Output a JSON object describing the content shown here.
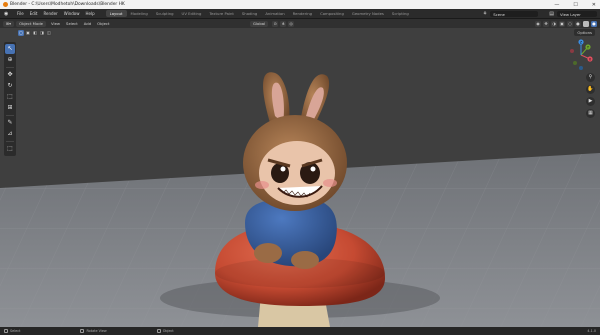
{
  "titlebar": {
    "title": "Blender - C:\\Users\\Modhetoh\\Downloads\\Blender HK",
    "min": "—",
    "max": "☐",
    "close": "✕"
  },
  "menu": {
    "items": [
      "File",
      "Edit",
      "Render",
      "Window",
      "Help"
    ]
  },
  "workspaces": {
    "tabs": [
      "Layout",
      "Modeling",
      "Sculpting",
      "UV Editing",
      "Texture Paint",
      "Shading",
      "Animation",
      "Rendering",
      "Compositing",
      "Geometry Nodes",
      "Scripting"
    ],
    "active": "Layout"
  },
  "scene": {
    "label": "Scene"
  },
  "view_layer": {
    "label": "View Layer"
  },
  "header": {
    "mode": "Object Mode",
    "menus": [
      "View",
      "Select",
      "Add",
      "Object"
    ],
    "transform": "Global"
  },
  "viewport": {
    "options_label": "Options",
    "gizmo": {
      "x": "X",
      "y": "Y",
      "z": "Z"
    },
    "colors": {
      "floor": "#7f8287",
      "sky": "#3f3f3f",
      "cap": "#c54a32",
      "fur": "#9a6b45",
      "hoodie": "#3a63a6"
    }
  },
  "statusbar": {
    "items": [
      "Select",
      "Rotate View",
      "Object"
    ],
    "version": "4.1.0"
  }
}
